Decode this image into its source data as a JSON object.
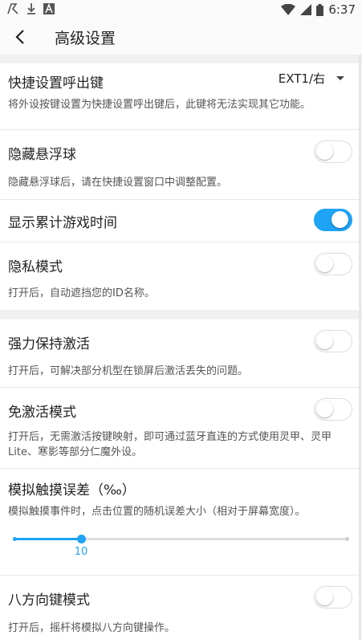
{
  "status_bar": {
    "time": "6:37",
    "icons": [
      "app-r-icon",
      "download-icon",
      "a-icon",
      "wifi-icon",
      "signal-icon",
      "battery-icon"
    ]
  },
  "app_bar": {
    "title": "高级设置"
  },
  "settings": {
    "quick_key": {
      "title": "快捷设置呼出键",
      "value": "EXT1/右",
      "desc": "将外设按键设置为快捷设置呼出键后，此键将无法实现其它功能。"
    },
    "hide_float": {
      "title": "隐藏悬浮球",
      "desc": "隐藏悬浮球后，请在快捷设置窗口中调整配置。",
      "on": false
    },
    "show_time": {
      "title": "显示累计游戏时间",
      "on": true
    },
    "privacy": {
      "title": "隐私模式",
      "desc": "打开后，自动遮挡您的ID名称。",
      "on": false
    },
    "keep_alive": {
      "title": "强力保持激活",
      "desc": "打开后，可解决部分机型在锁屏后激活丢失的问题。",
      "on": false
    },
    "no_activate": {
      "title": "免激活模式",
      "desc": "打开后，无需激活按键映射，即可通过蓝牙直连的方式使用灵甲、灵甲Lite、寒影等部分仁魔外设。",
      "on": false
    },
    "touch_error": {
      "title": "模拟触摸误差（‰）",
      "desc": "模拟触摸事件时，点击位置的随机误差大小（相对于屏幕宽度）。",
      "value": "10",
      "fraction": 0.2
    },
    "eight_dir": {
      "title": "八方向键模式",
      "desc": "打开后，摇杆将模拟八方向键操作。",
      "on": false
    }
  },
  "colors": {
    "accent": "#1ea3f5",
    "divider": "#f0f0f0"
  }
}
